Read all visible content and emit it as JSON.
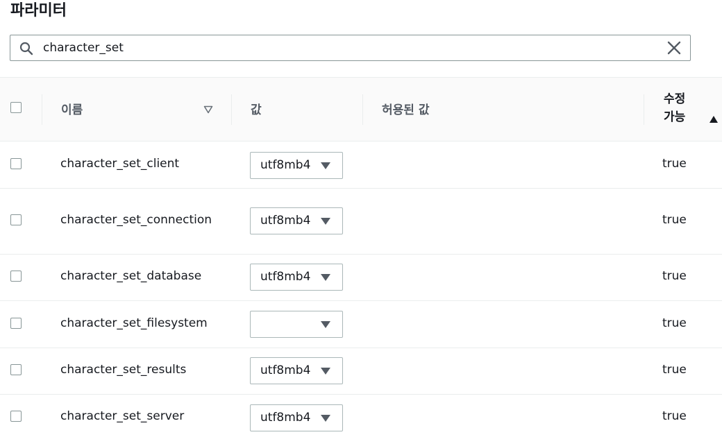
{
  "title": "파라미터",
  "search": {
    "value": "character_set",
    "icon": "search-icon",
    "clear_icon": "close-icon"
  },
  "columns": {
    "name": "이름",
    "value": "값",
    "allowed": "허용된 값",
    "modifiable_line1": "수정",
    "modifiable_line2": "가능"
  },
  "rows": [
    {
      "name": "character_set_client",
      "value": "utf8mb4",
      "allowed": "",
      "modifiable": "true"
    },
    {
      "name": "character_set_connection",
      "value": "utf8mb4",
      "allowed": "",
      "modifiable": "true"
    },
    {
      "name": "character_set_database",
      "value": "utf8mb4",
      "allowed": "",
      "modifiable": "true"
    },
    {
      "name": "character_set_filesystem",
      "value": "",
      "allowed": "",
      "modifiable": "true"
    },
    {
      "name": "character_set_results",
      "value": "utf8mb4",
      "allowed": "",
      "modifiable": "true"
    },
    {
      "name": "character_set_server",
      "value": "utf8mb4",
      "allowed": "",
      "modifiable": "true"
    }
  ],
  "colors": {
    "text": "#16191f",
    "header_text": "#545b64",
    "border": "#879596",
    "row_divider": "#eaeded"
  }
}
